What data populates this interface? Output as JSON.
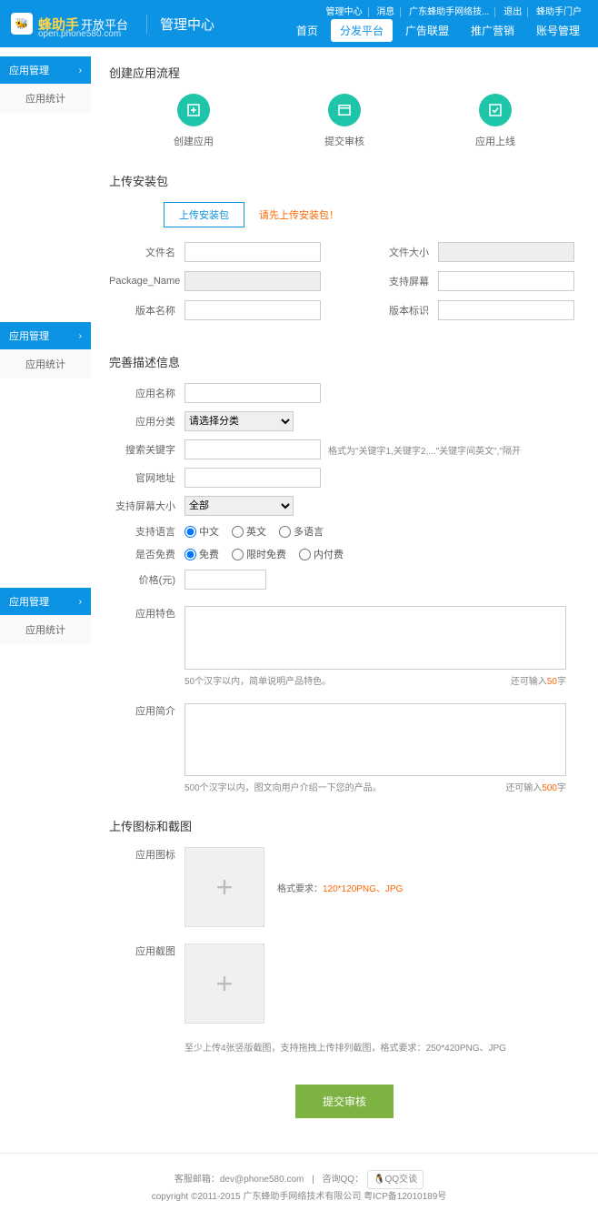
{
  "header": {
    "logo_name": "蜂助手",
    "logo_suffix": "开放平台",
    "logo_url": "open.phone580.com",
    "page_title": "管理中心"
  },
  "top_links": [
    "管理中心",
    "消息",
    "广东蜂助手网络技...",
    "退出",
    "蜂助手门户"
  ],
  "main_nav": {
    "items": [
      "首页",
      "分发平台",
      "广告联盟",
      "推广营销",
      "账号管理"
    ],
    "active_index": 1
  },
  "sidebar": {
    "blocks": [
      {
        "head": "应用管理",
        "items": [
          "应用统计"
        ]
      },
      {
        "head": "应用管理",
        "items": [
          "应用统计"
        ]
      },
      {
        "head": "应用管理",
        "items": [
          "应用统计"
        ]
      }
    ]
  },
  "flow": {
    "title": "创建应用流程",
    "steps": [
      "创建应用",
      "提交审核",
      "应用上线"
    ]
  },
  "upload_pkg": {
    "title": "上传安装包",
    "btn": "上传安装包",
    "warn": "请先上传安装包！",
    "fields_left": [
      "文件名",
      "Package_Name",
      "版本名称"
    ],
    "fields_right": [
      "文件大小",
      "支持屏幕",
      "版本标识"
    ]
  },
  "desc": {
    "title": "完善描述信息",
    "labels": {
      "name": "应用名称",
      "category": "应用分类",
      "keywords": "搜索关键字",
      "weburl": "官网地址",
      "screen": "支持屏幕大小",
      "lang": "支持语言",
      "free": "是否免费",
      "price": "价格(元)",
      "feature": "应用特色",
      "intro": "应用简介"
    },
    "category_placeholder": "请选择分类",
    "keyword_hint": "格式为\"关键字1,关键字2,...\"关键字间英文\",\"隔开",
    "screen_option": "全部",
    "lang_opts": [
      "中文",
      "英文",
      "多语言"
    ],
    "free_opts": [
      "免费",
      "限时免费",
      "内付费"
    ],
    "feature_hint": "50个汉字以内，简单说明产品特色。",
    "feature_count_prefix": "还可输入",
    "feature_count_num": "50",
    "feature_count_suffix": "字",
    "intro_hint": "500个汉字以内，图文向用户介绍一下您的产品。",
    "intro_count_num": "500"
  },
  "icons": {
    "title": "上传图标和截图",
    "logo_label": "应用图标",
    "logo_hint_prefix": "格式要求：",
    "logo_hint_spec": "120*120PNG、JPG",
    "screenshot_label": "应用截图",
    "screenshot_hint": "至少上传4张竖版截图，支持拖拽上传排列截图，格式要求：",
    "screenshot_spec": "250*420PNG、JPG"
  },
  "submit": {
    "btn": "提交审核"
  },
  "footer": {
    "email_label": "客服邮箱：",
    "email": "dev@phone580.com",
    "qq_label": "咨询QQ：",
    "qq_btn": "QQ交谈",
    "copyright": "copyright ©2011-2015 广东蜂助手网络技术有限公司 粤ICP备12010189号"
  }
}
